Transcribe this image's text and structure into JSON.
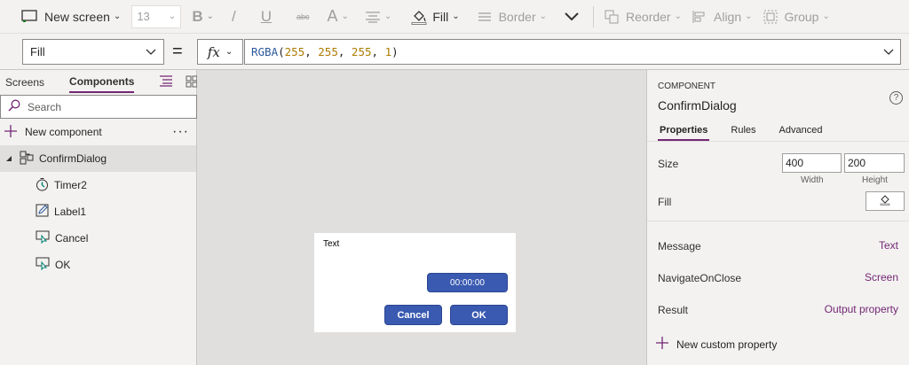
{
  "toolbar": {
    "new_screen": "New screen",
    "font_size": "13",
    "bold": "B",
    "italic": "/",
    "underline": "U",
    "strike": "abc",
    "font_color": "A",
    "fill": "Fill",
    "border": "Border",
    "reorder": "Reorder",
    "align": "Align",
    "group": "Group"
  },
  "formula_bar": {
    "property": "Fill",
    "equals": "=",
    "fx": "fx",
    "formula": {
      "fn": "RGBA",
      "open": "(",
      "a": "255",
      "c1": ", ",
      "b": "255",
      "c2": ", ",
      "c": "255",
      "c3": ", ",
      "d": "1",
      "close": ")"
    }
  },
  "left_panel": {
    "tabs": [
      "Screens",
      "Components"
    ],
    "active_tab": "Components",
    "search_placeholder": "Search",
    "new_component": "New component",
    "tree": {
      "root": "ConfirmDialog",
      "children": [
        "Timer2",
        "Label1",
        "Cancel",
        "OK"
      ]
    }
  },
  "canvas": {
    "dialog": {
      "text": "Text",
      "timer": "00:00:00",
      "cancel": "Cancel",
      "ok": "OK"
    }
  },
  "right_panel": {
    "category": "COMPONENT",
    "title": "ConfirmDialog",
    "help": "?",
    "tabs": [
      "Properties",
      "Rules",
      "Advanced"
    ],
    "size_label": "Size",
    "width": "400",
    "height": "200",
    "width_caption": "Width",
    "height_caption": "Height",
    "fill_label": "Fill",
    "custom_props": [
      {
        "name": "Message",
        "value": "Text"
      },
      {
        "name": "NavigateOnClose",
        "value": "Screen"
      },
      {
        "name": "Result",
        "value": "Output property"
      }
    ],
    "new_custom_property": "New custom property"
  },
  "colors": {
    "accent": "#742774",
    "button": "#3a5ab1",
    "canvas": "#e1dfdd"
  }
}
